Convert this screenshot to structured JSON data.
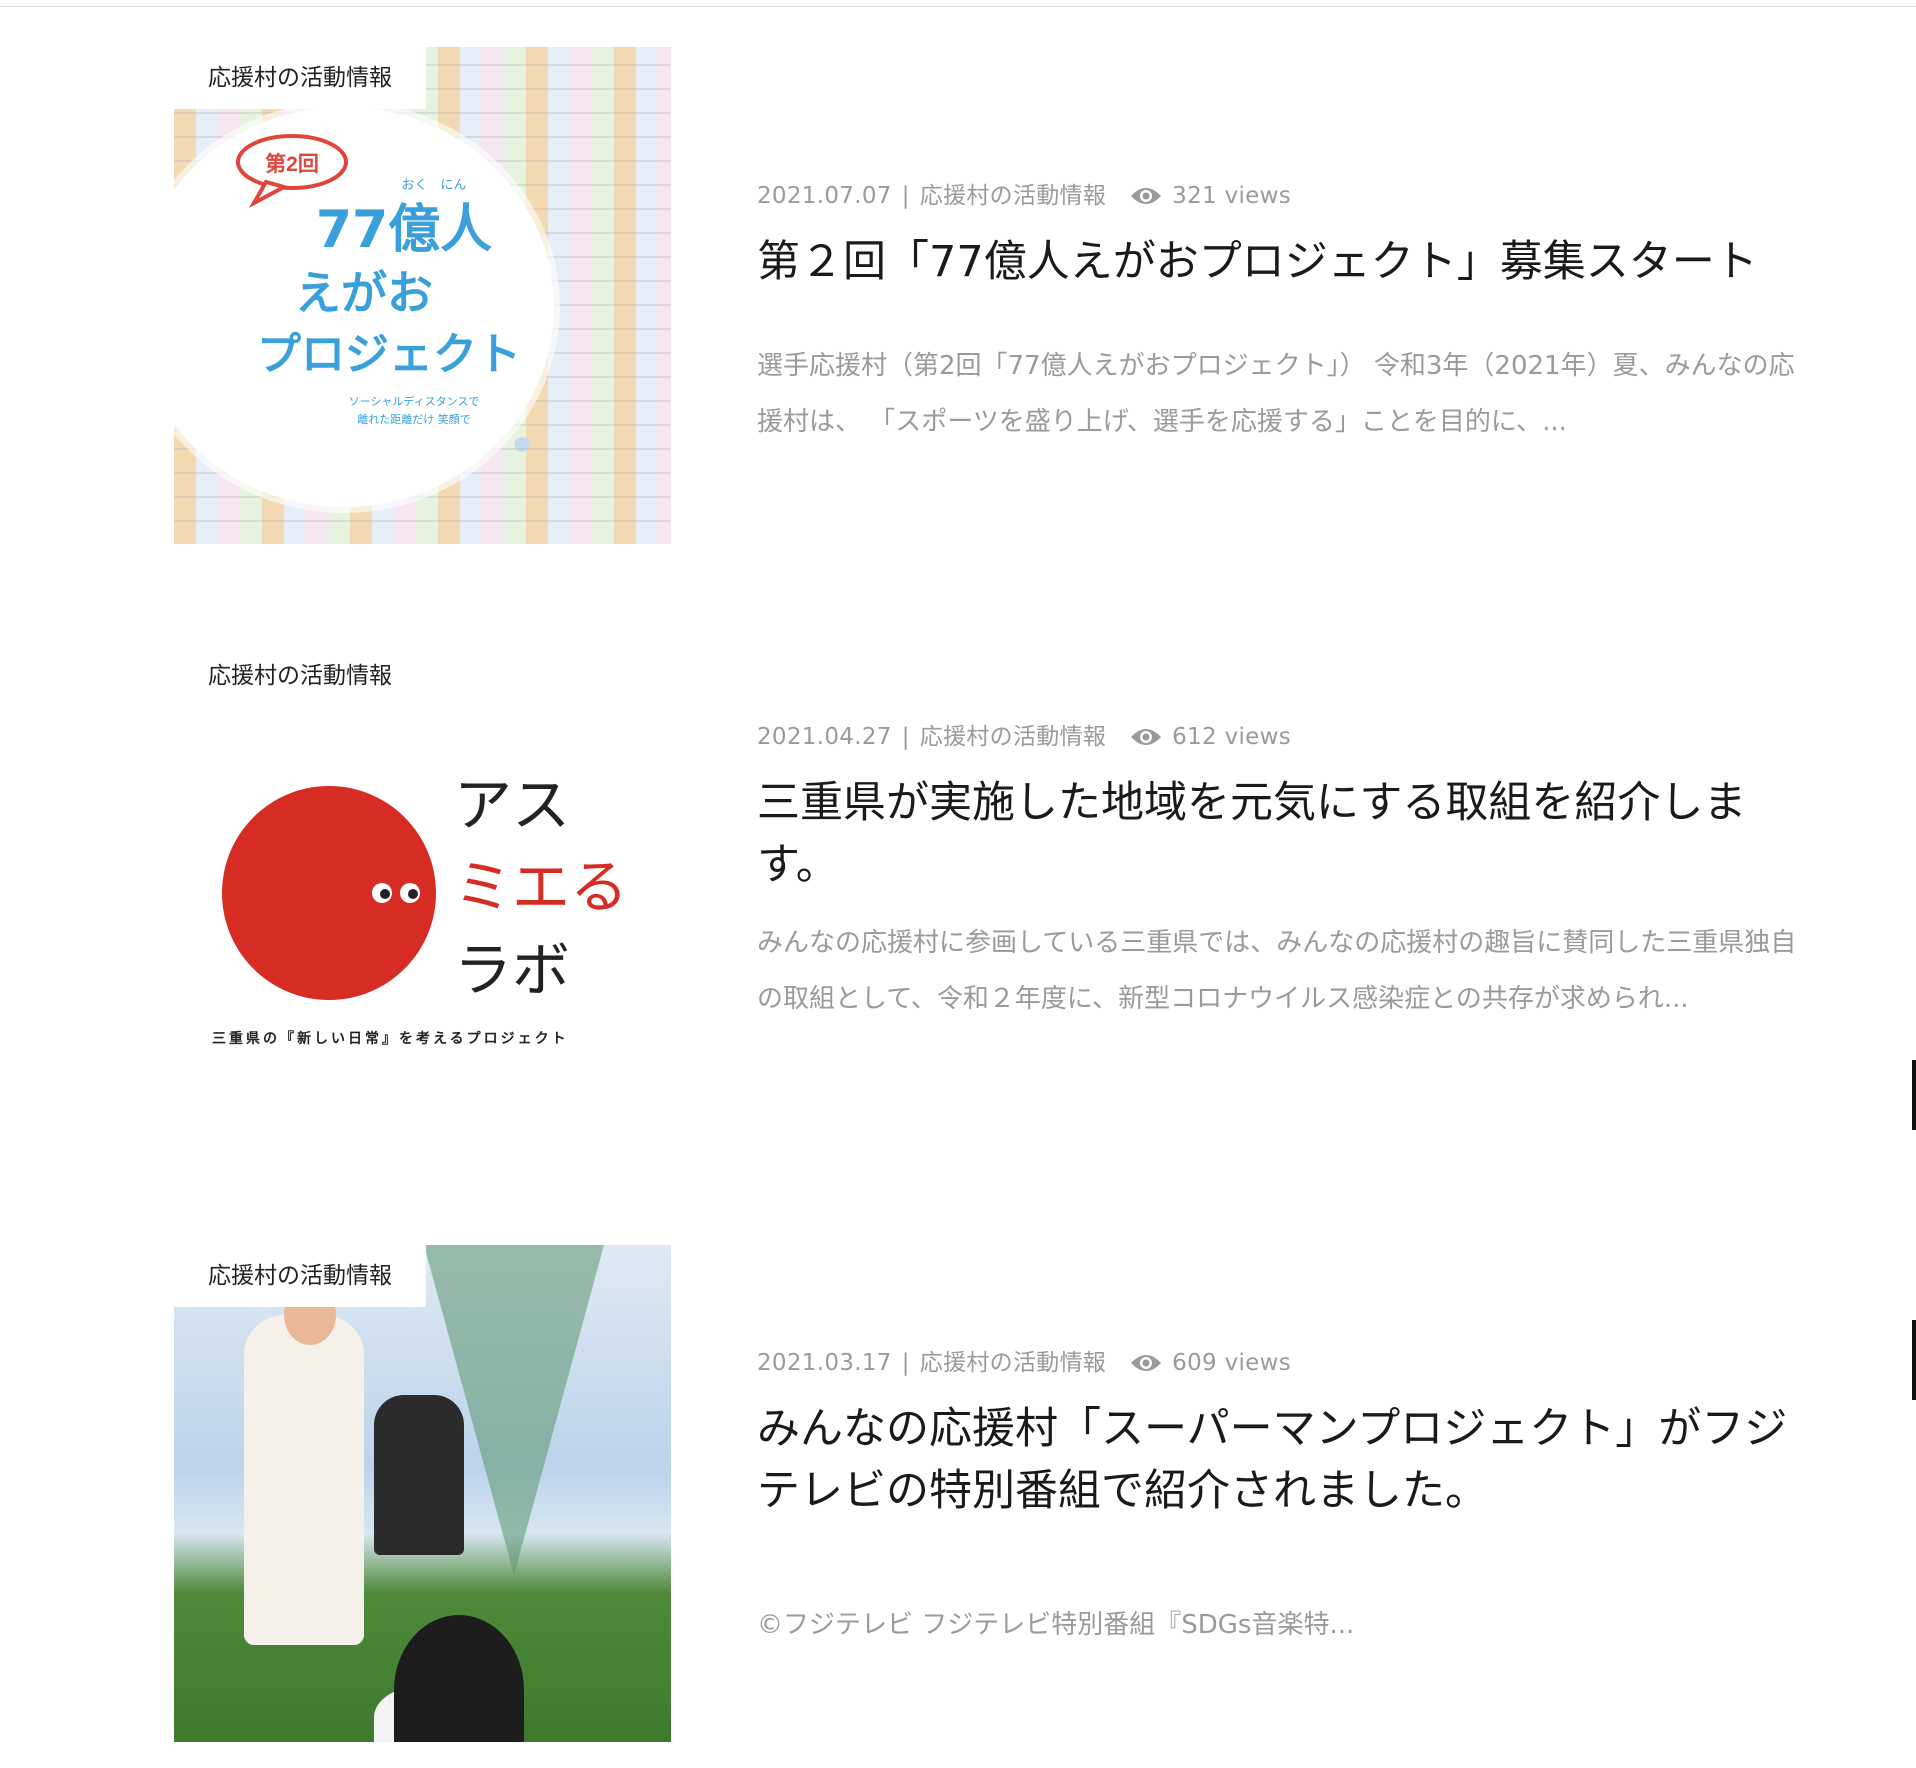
{
  "posts": [
    {
      "category_tag": "応援村の活動情報",
      "date": "2021.07.07",
      "separator": "|",
      "category": "応援村の活動情報",
      "views": "321 views",
      "title": "第２回「77億人えがおプロジェクト」募集スタート",
      "excerpt": "選手応援村（第2回「77億人えがおプロジェクト」） 令和3年（2021年）夏、みんなの応援村は、 「スポーツを盛り上げ、選手を応援する」ことを目的に、...",
      "thumbnail": {
        "badge": "第2回",
        "furigana": "おく　にん",
        "title_lines": [
          "77億人",
          "えがお",
          "プロジェクト"
        ],
        "subtitle_lines": [
          "ソーシャルディスタンスで",
          "離れた距離だけ 笑顔で"
        ]
      }
    },
    {
      "category_tag": "応援村の活動情報",
      "date": "2021.04.27",
      "separator": "|",
      "category": "応援村の活動情報",
      "views": "612 views",
      "title": "三重県が実施した地域を元気にする取組を紹介します。",
      "excerpt": "みんなの応援村に参画している三重県では、みんなの応援村の趣旨に賛同した三重県独自の取組として、令和２年度に、新型コロナウイルス感染症との共存が求められ...",
      "thumbnail": {
        "logo_lines": [
          "アス",
          "ミエる",
          "ラボ"
        ],
        "tagline": "三重県の『新しい日常』を考えるプロジェクト"
      }
    },
    {
      "category_tag": "応援村の活動情報",
      "date": "2021.03.17",
      "separator": "|",
      "category": "応援村の活動情報",
      "views": "609 views",
      "title": "みんなの応援村「スーパーマンプロジェクト」がフジテレビの特別番組で紹介されました。",
      "excerpt": "©フジテレビ フジテレビ特別番組『SDGs音楽特..."
    }
  ],
  "colors": {
    "meta_gray": "#9a9a9a",
    "title_black": "#1a1a1a",
    "mie_red": "#d62c24",
    "egao_blue": "#3aa0dc"
  }
}
